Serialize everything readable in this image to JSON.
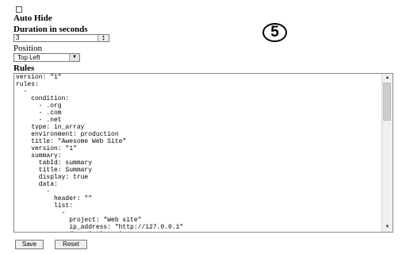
{
  "settings": {
    "auto_hide_label": "Auto Hide",
    "duration_label": "Duration in seconds",
    "duration_value": "3",
    "position_label": "Position",
    "position_value": "Top Left",
    "rules_label": "Rules"
  },
  "badge": {
    "number": "5"
  },
  "rules_text": "version: \"1\"\nrules:\n  -\n    condition:\n      - .org\n      - .com\n      - .net\n    type: in_array\n    environment: production\n    title: \"Awesome Web Site\"\n    version: \"1\"\n    summary:\n      tabId: summary\n      title: Summary\n      display: true\n      data:\n        -\n          header: \"\"\n          list:\n            -\n              project: \"Web site\"\n              ip_address: \"http://127.0.0.1\"\n              description: |-\n                html://This is a demo data to show the addon\ncapabilities<br>\n                The <b>Summary</b>tab is <b>mondatory</b>.\n                You can add any useful data thier",
  "buttons": {
    "save": "Save",
    "reset": "Reset"
  },
  "icons": {
    "spin_up": "spin-up-arrow-icon",
    "spin_down": "spin-down-arrow-icon",
    "dropdown": "chevron-down-icon",
    "scroll_up": "scroll-up-arrow-icon",
    "scroll_down": "scroll-down-arrow-icon"
  }
}
